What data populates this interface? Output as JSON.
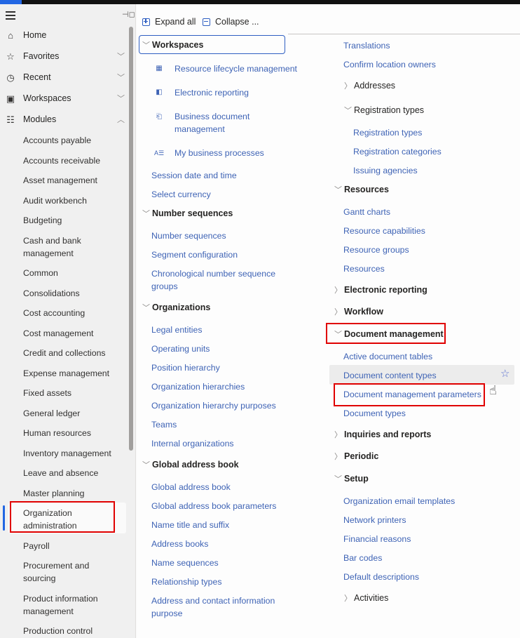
{
  "sidebar": {
    "nav": [
      {
        "label": "Home",
        "icon": "home-icon",
        "glyph": "⌂",
        "chevron": ""
      },
      {
        "label": "Favorites",
        "icon": "star-icon",
        "glyph": "☆",
        "chevron": "⌄"
      },
      {
        "label": "Recent",
        "icon": "clock-icon",
        "glyph": "◷",
        "chevron": "⌄"
      },
      {
        "label": "Workspaces",
        "icon": "workspace-icon",
        "glyph": "▣",
        "chevron": "⌄"
      },
      {
        "label": "Modules",
        "icon": "modules-list-icon",
        "glyph": "☷",
        "chevron": "⌃"
      }
    ],
    "modules": [
      "Accounts payable",
      "Accounts receivable",
      "Asset management",
      "Audit workbench",
      "Budgeting",
      "Cash and bank management",
      "Common",
      "Consolidations",
      "Cost accounting",
      "Cost management",
      "Credit and collections",
      "Expense management",
      "Fixed assets",
      "General ledger",
      "Human resources",
      "Inventory management",
      "Leave and absence",
      "Master planning",
      "Organization administration",
      "Payroll",
      "Procurement and sourcing",
      "Product information management",
      "Production control"
    ],
    "selected_module": "Organization administration"
  },
  "toolbar": {
    "expand_all": "Expand all",
    "collapse_all": "Collapse ..."
  },
  "left_column": {
    "workspaces": {
      "header": "Workspaces",
      "items": [
        {
          "label": "Resource lifecycle management",
          "icon": "resource-lifecycle-icon"
        },
        {
          "label": "Electronic reporting",
          "icon": "electronic-reporting-icon"
        },
        {
          "label": "Business document management",
          "icon": "business-document-icon"
        },
        {
          "label": "My business processes",
          "icon": "business-processes-icon"
        }
      ]
    },
    "loose_links": [
      "Session date and time",
      "Select currency"
    ],
    "number_sequences": {
      "header": "Number sequences",
      "items": [
        "Number sequences",
        "Segment configuration",
        "Chronological number sequence groups"
      ]
    },
    "organizations": {
      "header": "Organizations",
      "items": [
        "Legal entities",
        "Operating units",
        "Position hierarchy",
        "Organization hierarchies",
        "Organization hierarchy purposes",
        "Teams",
        "Internal organizations"
      ]
    },
    "global_address_book": {
      "header": "Global address book",
      "items": [
        "Global address book",
        "Global address book parameters",
        "Name title and suffix",
        "Address books",
        "Name sequences",
        "Relationship types",
        "Address and contact information purpose"
      ]
    }
  },
  "right_column": {
    "top_links": [
      "Translations",
      "Confirm location owners"
    ],
    "addresses": {
      "header": "Addresses",
      "expanded": false
    },
    "registration_types": {
      "header": "Registration types",
      "items": [
        "Registration types",
        "Registration categories",
        "Issuing agencies"
      ]
    },
    "resources": {
      "header": "Resources",
      "items": [
        "Gantt charts",
        "Resource capabilities",
        "Resource groups",
        "Resources"
      ]
    },
    "electronic_reporting": {
      "header": "Electronic reporting",
      "expanded": false
    },
    "workflow": {
      "header": "Workflow",
      "expanded": false
    },
    "document_management": {
      "header": "Document management",
      "items": [
        "Active document tables",
        "Document content types",
        "Document management parameters",
        "Document types"
      ],
      "hovered_item": "Document content types",
      "highlighted_item": "Document management parameters"
    },
    "inquiries_and_reports": {
      "header": "Inquiries and reports",
      "expanded": false
    },
    "periodic": {
      "header": "Periodic",
      "expanded": false
    },
    "setup": {
      "header": "Setup",
      "items": [
        "Organization email templates",
        "Network printers",
        "Financial reasons",
        "Bar codes",
        "Default descriptions"
      ]
    },
    "activities": {
      "header": "Activities",
      "expanded": false
    }
  },
  "colors": {
    "link": "#3e63b5",
    "accent": "#2266e3",
    "highlight_box": "#e00000"
  }
}
